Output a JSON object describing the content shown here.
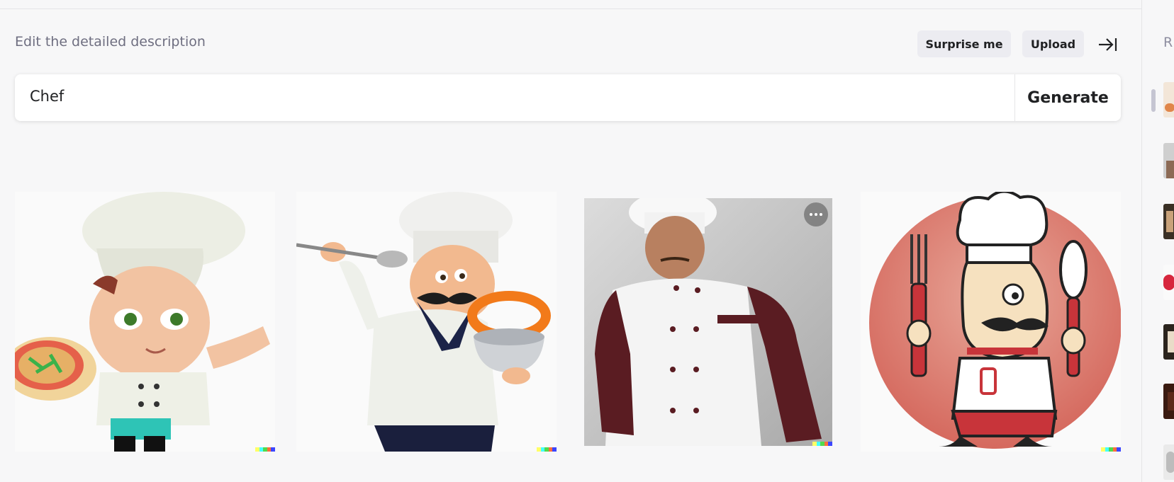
{
  "editor": {
    "heading": "Edit the detailed description",
    "surprise_label": "Surprise me",
    "upload_label": "Upload",
    "prompt_value": "Chef",
    "generate_label": "Generate"
  },
  "results": [
    {
      "name": "cartoon-boy-chef-with-pizza"
    },
    {
      "name": "cartoon-chef-with-spoon-and-bowl"
    },
    {
      "name": "photo-chef-in-white-jacket"
    },
    {
      "name": "cartoon-chef-with-fork-and-spoon"
    }
  ],
  "colors": {
    "accent_red": "#d9534f",
    "signature": [
      "#ffff66",
      "#42ffff",
      "#51da4c",
      "#ff6e3c",
      "#3c46ff"
    ]
  },
  "sidebar": {
    "heading": "R"
  }
}
